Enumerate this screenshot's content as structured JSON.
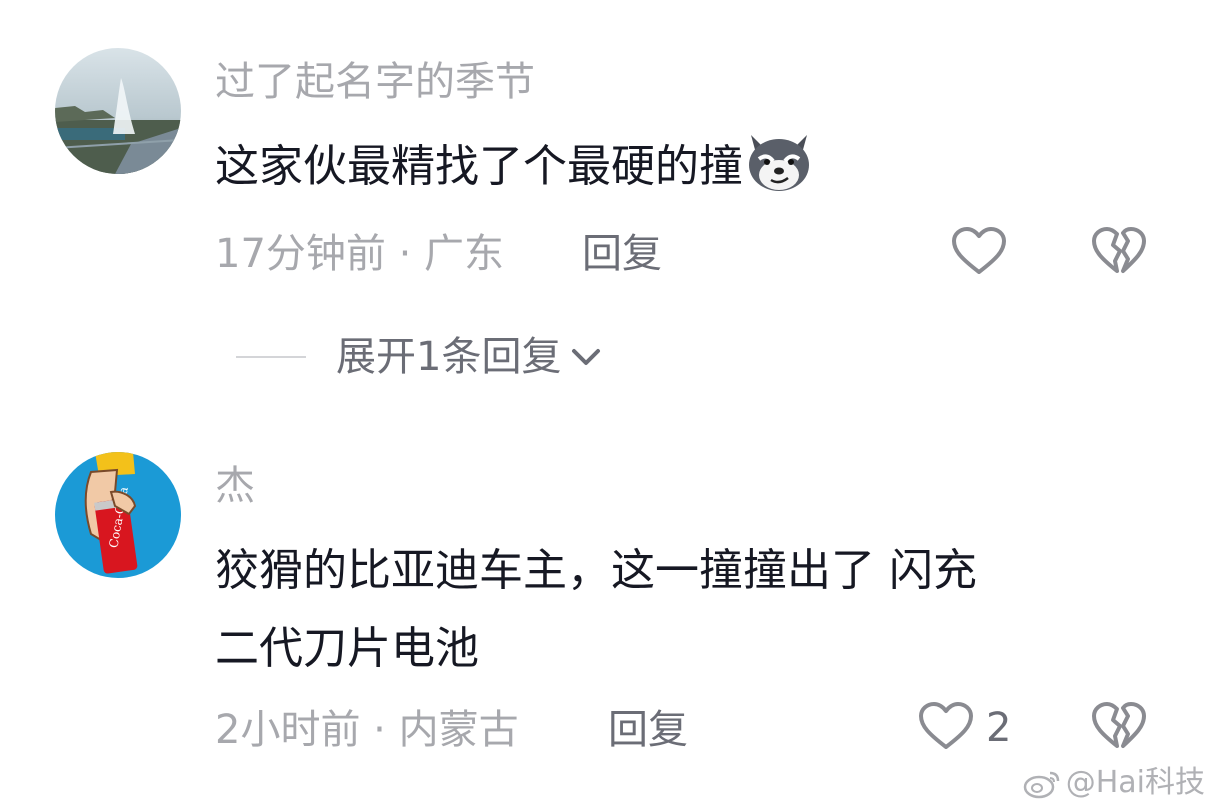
{
  "comments": [
    {
      "username": "过了起名字的季节",
      "text": "这家伙最精找了个最硬的撞",
      "emoji": "dog-smirk-emoji",
      "meta": "17分钟前 · 广东",
      "reply_label": "回复",
      "like_icon": "heart-outline-icon",
      "dislike_icon": "broken-heart-icon",
      "expand_label": "展开1条回复"
    },
    {
      "username": "杰",
      "text_line1": "狡猾的比亚迪车主，这一撞撞出了 闪充",
      "text_line2": "二代刀片电池",
      "meta": "2小时前 · 内蒙古",
      "reply_label": "回复",
      "like_count": "2",
      "like_icon": "heart-outline-icon",
      "dislike_icon": "broken-heart-icon"
    }
  ],
  "watermark": {
    "platform_icon": "weibo-icon",
    "text": "@Hai科技"
  },
  "colors": {
    "primary_text": "#161823",
    "secondary_text": "#a7a8ad",
    "action_text": "#6b6d76"
  }
}
